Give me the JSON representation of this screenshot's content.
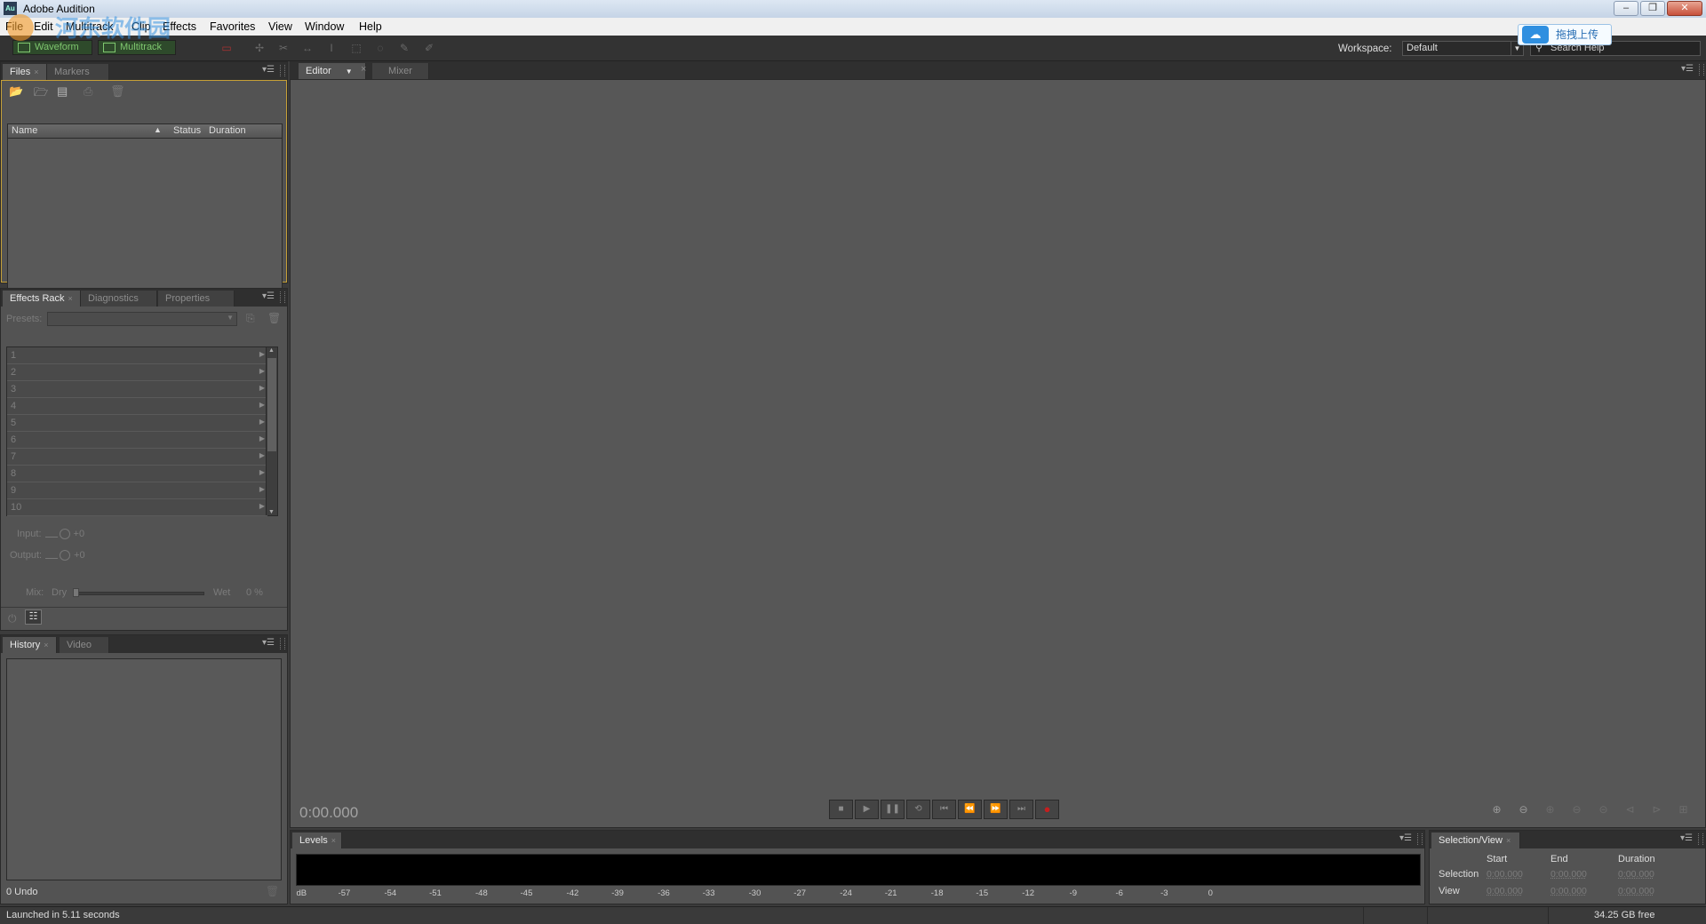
{
  "window": {
    "title": "Adobe Audition",
    "app_icon": "Au",
    "controls": {
      "minimize": "–",
      "restore": "❐",
      "close": "✕"
    }
  },
  "menu": [
    "File",
    "Edit",
    "Multitrack",
    "Clip",
    "Effects",
    "Favorites",
    "View",
    "Window",
    "Help"
  ],
  "toolbar": {
    "waveform_label": "Waveform",
    "multitrack_label": "Multitrack",
    "workspace_label": "Workspace:",
    "workspace_value": "Default",
    "search_placeholder": "Search Help"
  },
  "upload_overlay": {
    "label": "拖拽上传"
  },
  "watermark": {
    "text": "河东软件园"
  },
  "files_panel": {
    "tabs": [
      "Files",
      "Markers"
    ],
    "columns": {
      "name": "Name",
      "status": "Status",
      "duration": "Duration"
    },
    "rows": []
  },
  "effects_panel": {
    "tabs": [
      "Effects Rack",
      "Diagnostics",
      "Properties"
    ],
    "presets_label": "Presets:",
    "slots": [
      "1",
      "2",
      "3",
      "4",
      "5",
      "6",
      "7",
      "8",
      "9",
      "10"
    ],
    "input_label": "Input:",
    "input_value": "+0",
    "output_label": "Output:",
    "output_value": "+0",
    "mix_label": "Mix:",
    "dry_label": "Dry",
    "wet_label": "Wet",
    "mix_value": "0 %"
  },
  "history_panel": {
    "tabs": [
      "History",
      "Video"
    ],
    "undo_count": "0 Undo"
  },
  "editor": {
    "tabs": [
      "Editor",
      "Mixer"
    ],
    "timecode": "0:00.000"
  },
  "levels": {
    "tab": "Levels",
    "scale": [
      "dB",
      "-57",
      "-54",
      "-51",
      "-48",
      "-45",
      "-42",
      "-39",
      "-36",
      "-33",
      "-30",
      "-27",
      "-24",
      "-21",
      "-18",
      "-15",
      "-12",
      "-9",
      "-6",
      "-3",
      "0"
    ]
  },
  "selection_view": {
    "tab": "Selection/View",
    "col_start": "Start",
    "col_end": "End",
    "col_duration": "Duration",
    "selection_label": "Selection",
    "view_label": "View",
    "selection": {
      "start": "0:00.000",
      "end": "0:00.000",
      "duration": "0:00.000"
    },
    "view": {
      "start": "0:00.000",
      "end": "0:00.000",
      "duration": "0:00.000"
    }
  },
  "status": {
    "message": "Launched in 5.11 seconds",
    "disk_free": "34.25 GB free"
  }
}
